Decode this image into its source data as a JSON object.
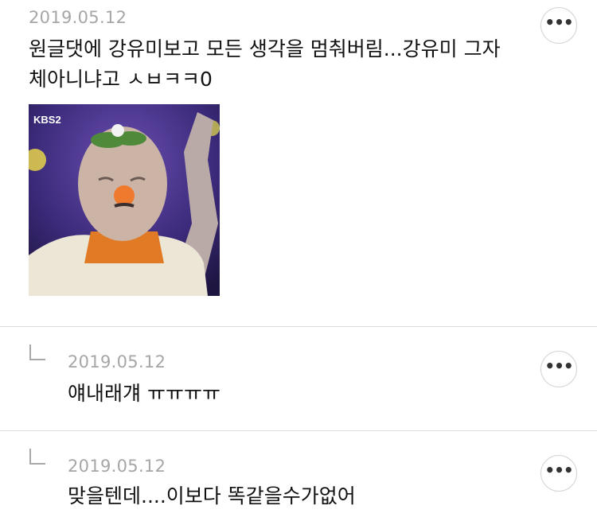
{
  "comments": [
    {
      "date": "2019.05.12",
      "text_line1": "원글댓에 강유미보고 모든 생각을 멈춰버림...강유미 그자",
      "text_line2": "체아니냐고 ㅅㅂㅋㅋ0",
      "image": {
        "icon": "photo-image",
        "tv_logo": "KBS2"
      },
      "more_label": "•••"
    },
    {
      "date": "2019.05.12",
      "text": "얘내래걔 ㅠㅠㅠㅠ",
      "more_label": "•••",
      "reply_icon": "reply-arrow-icon"
    },
    {
      "date": "2019.05.12",
      "text": "맞을텐데....이보다 똑같을수가없어",
      "more_label": "•••",
      "reply_icon": "reply-arrow-icon"
    }
  ],
  "colors": {
    "date": "#a6a6a6",
    "text": "#111111",
    "divider": "#dedede",
    "button_border": "#d4d4d4"
  }
}
